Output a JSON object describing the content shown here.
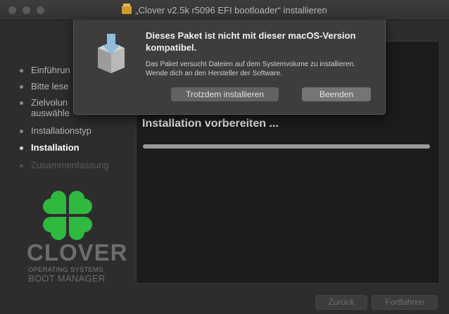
{
  "window": {
    "title": "„Clover v2.5k r5096 EFI bootloader“ installieren"
  },
  "sidebar": {
    "steps": [
      {
        "label": "Einführun",
        "state": "done"
      },
      {
        "label": "Bitte lese",
        "state": "done"
      },
      {
        "label": "Zielvolun",
        "label2": "auswähle",
        "state": "done"
      },
      {
        "label": "Installationstyp",
        "state": "done"
      },
      {
        "label": "Installation",
        "state": "active"
      },
      {
        "label": "Zusammenfassung",
        "state": "pending"
      }
    ]
  },
  "brand": {
    "name": "CLOVER",
    "line1": "OPERATING SYSTEMS",
    "line2": "BOOT MANAGER"
  },
  "content": {
    "heading": "Installation vorbereiten ...",
    "progress": 1.0
  },
  "footer": {
    "back_label": "Zurück",
    "continue_label": "Fortfahren"
  },
  "dialog": {
    "title": "Dieses Paket ist nicht mit dieser macOS-Version kompatibel.",
    "body": "Das Paket versucht Dateien auf dem Systemvolume zu installieren. Wende dich an den Hersteller der Software.",
    "install_anyway_label": "Trotzdem installieren",
    "quit_label": "Beenden"
  },
  "colors": {
    "clover_green": "#2fb93f",
    "window_bg": "#2d2d2d",
    "panel_bg": "#1c1c1c"
  }
}
